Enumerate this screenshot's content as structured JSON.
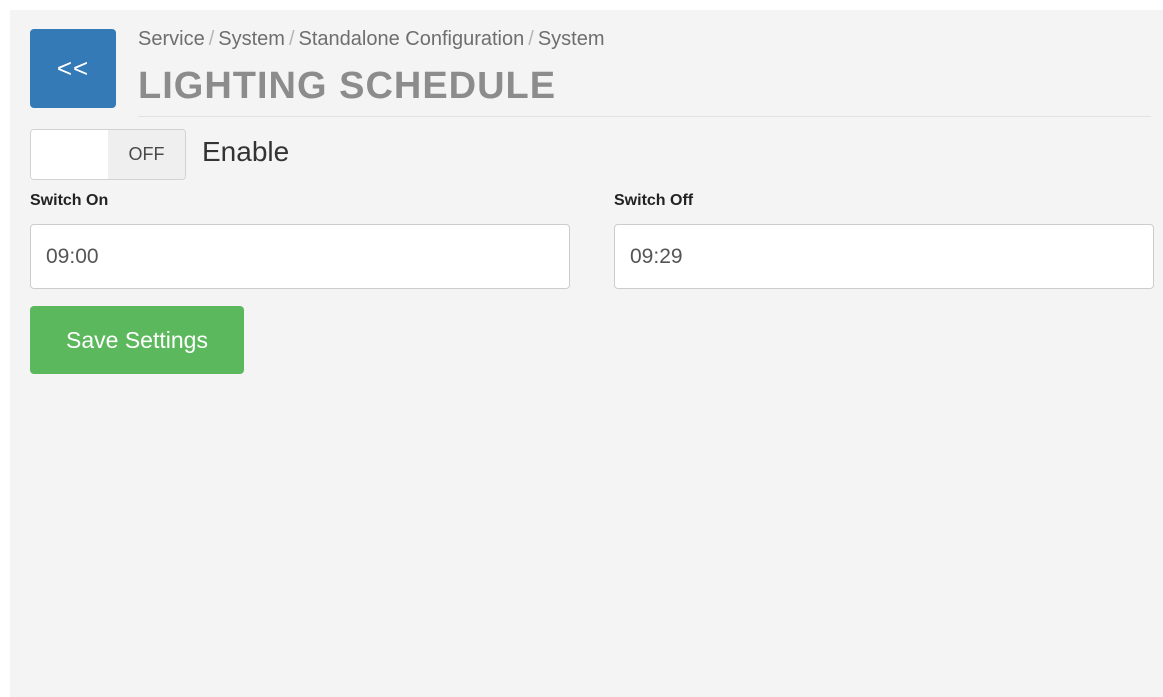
{
  "header": {
    "back_label": "<<",
    "breadcrumb": [
      "Service",
      "System",
      "Standalone Configuration",
      "System"
    ],
    "breadcrumb_separator": "/",
    "title": "LIGHTING SCHEDULE"
  },
  "enable_toggle": {
    "state_label": "OFF",
    "checked": false,
    "label": "Enable"
  },
  "switch_on": {
    "label": "Switch On",
    "value": "09:00"
  },
  "switch_off": {
    "label": "Switch Off",
    "value": "09:29"
  },
  "save_button": {
    "label": "Save Settings"
  },
  "colors": {
    "back_button": "#337ab7",
    "save_button": "#5cb85c",
    "panel_background": "#f4f4f4"
  }
}
